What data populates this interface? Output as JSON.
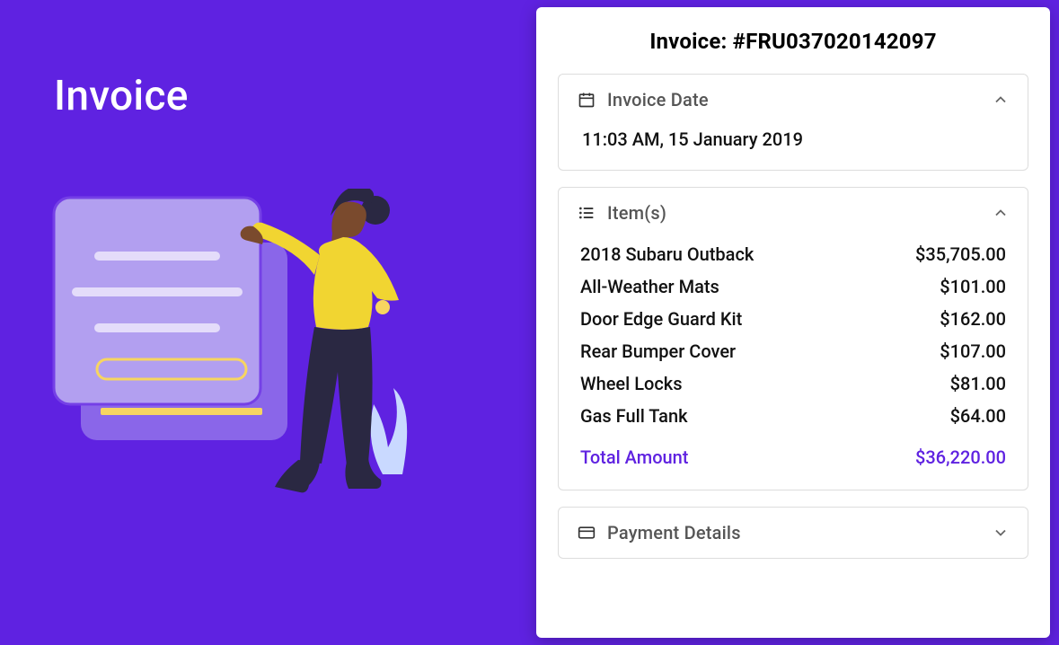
{
  "page": {
    "title": "Invoice"
  },
  "invoice": {
    "header_prefix": "Invoice: ",
    "number": "#FRU037020142097"
  },
  "sections": {
    "date": {
      "title": "Invoice Date",
      "value": "11:03 AM, 15 January 2019"
    },
    "items": {
      "title": "Item(s)",
      "rows": [
        {
          "name": "2018 Subaru Outback",
          "price": "$35,705.00"
        },
        {
          "name": "All-Weather Mats",
          "price": "$101.00"
        },
        {
          "name": "Door Edge Guard Kit",
          "price": "$162.00"
        },
        {
          "name": "Rear Bumper Cover",
          "price": "$107.00"
        },
        {
          "name": "Wheel Locks",
          "price": "$81.00"
        },
        {
          "name": "Gas Full Tank",
          "price": "$64.00"
        }
      ],
      "total_label": "Total Amount",
      "total_value": "$36,220.00"
    },
    "payment": {
      "title": "Payment Details"
    }
  },
  "colors": {
    "accent": "#5f22e1"
  }
}
